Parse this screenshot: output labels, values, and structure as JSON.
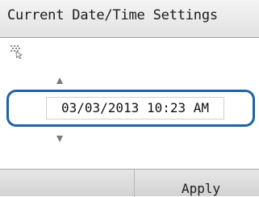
{
  "header": {
    "title": "Current Date/Time Settings"
  },
  "icons": {
    "hint": "touch-hint-icon",
    "increase": "arrow-up-icon",
    "decrease": "arrow-down-icon"
  },
  "datetime": {
    "value": "03/03/2013 10:23 AM"
  },
  "softkeys": {
    "right_label": "Apply"
  },
  "colors": {
    "focus_border": "#1e63a6"
  }
}
